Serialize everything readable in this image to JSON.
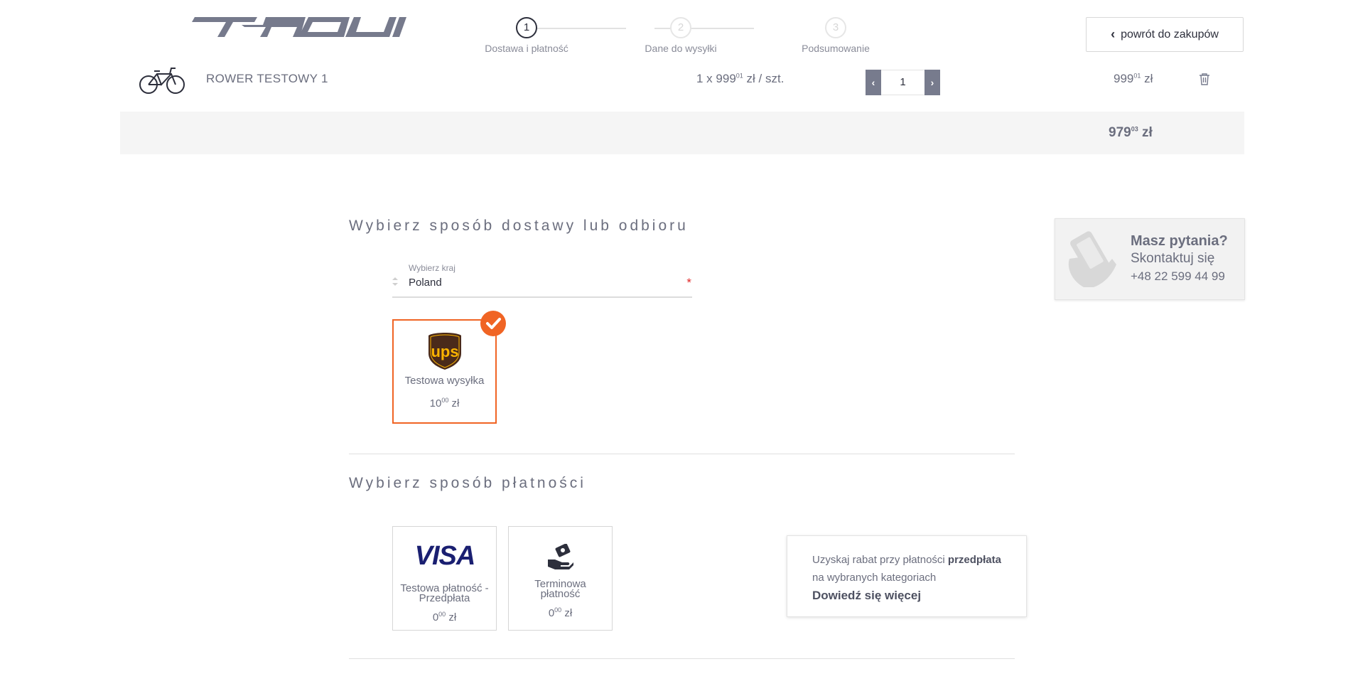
{
  "header": {
    "logo_text": "TABOU",
    "steps": [
      {
        "number": "1",
        "label": "Dostawa i płatność"
      },
      {
        "number": "2",
        "label": "Dane do wysyłki"
      },
      {
        "number": "3",
        "label": "Podsumowanie"
      }
    ],
    "active_step": 1,
    "back_button": "powrót do zakupów"
  },
  "cart": {
    "item": {
      "name": "ROWER TESTOWY 1",
      "unit_prefix": "1 x ",
      "unit_main": "999",
      "unit_cents": "01",
      "unit_suffix": " zł / szt.",
      "quantity": "1",
      "total_main": "999",
      "total_cents": "01",
      "total_suffix": " zł"
    },
    "grand_total_main": "979",
    "grand_total_cents": "03",
    "grand_total_suffix": " zł"
  },
  "delivery": {
    "title": "Wybierz sposób dostawy lub odbioru",
    "country_label": "Wybierz kraj",
    "country_value": "Poland",
    "required_mark": "*",
    "options": [
      {
        "logo_text": "ups",
        "name": "Testowa wysyłka",
        "price_main": "10",
        "price_cents": "00",
        "price_suffix": " zł",
        "selected": true
      }
    ]
  },
  "payment": {
    "title": "Wybierz sposób płatności",
    "options": [
      {
        "logo_text": "VISA",
        "name_line1": "Testowa płatność -",
        "name_line2": "Przedpłata",
        "price_main": "0",
        "price_cents": "00",
        "price_suffix": " zł"
      },
      {
        "logo_text": "",
        "name_line1": "Terminowa",
        "name_line2": "płatność",
        "price_main": "0",
        "price_cents": "00",
        "price_suffix": " zł"
      }
    ]
  },
  "promo": {
    "text1": "Uzyskaj rabat przy płatności ",
    "text1_bold": "przedpłata",
    "text2": "na wybranych kategoriach",
    "link": "Dowiedź się więcej"
  },
  "help": {
    "title": "Masz pytania?",
    "subtitle": "Skontaktuj się",
    "phone": "+48 22 599 44 99"
  },
  "colors": {
    "accent": "#f06424",
    "text": "#6b6e7e",
    "dark": "#2d2f3c",
    "qty_button": "#777b8d",
    "ups_brown": "#4a2a1a",
    "ups_gold": "#fbb400",
    "visa_blue": "#1a1f71"
  },
  "icons": {
    "logo": "tabou-logo",
    "product": "bicycle-icon",
    "delete": "trash-icon",
    "back": "chevron-left-icon",
    "selected": "checkmark-icon",
    "help": "phone-hand-icon",
    "cash": "money-hand-icon"
  }
}
